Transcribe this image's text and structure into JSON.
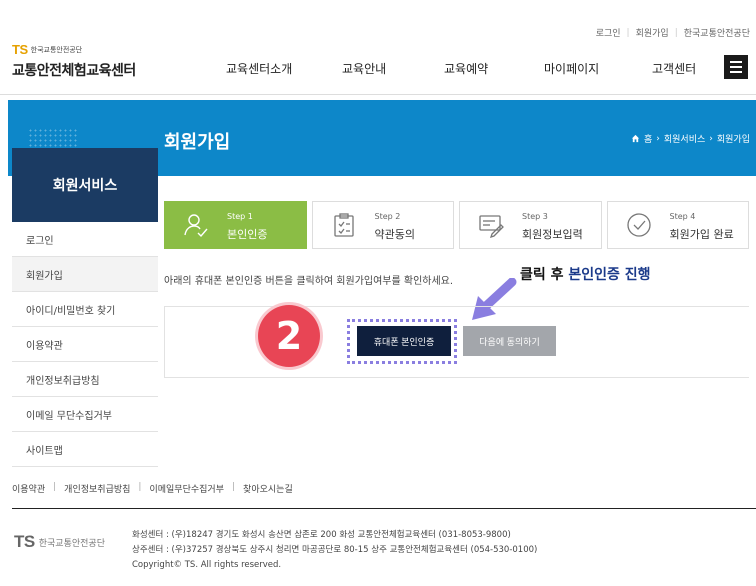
{
  "header": {
    "util_links": [
      "로그인",
      "회원가입",
      "한국교통안전공단"
    ],
    "logo_mark": "TS",
    "logo_org": "한국교통안전공단",
    "site_title": "교통안전체험교육센터",
    "nav": [
      "교육센터소개",
      "교육안내",
      "교육예약",
      "마이페이지",
      "고객센터"
    ],
    "menu_icon": "hamburger-icon"
  },
  "banner": {
    "title": "회원가입",
    "breadcrumb": [
      "홈",
      "회원서비스",
      "회원가입"
    ]
  },
  "sidebar": {
    "title": "회원서비스",
    "items": [
      {
        "label": "로그인"
      },
      {
        "label": "회원가입"
      },
      {
        "label": "아이디/비밀번호 찾기"
      },
      {
        "label": "이용약관"
      },
      {
        "label": "개인정보취급방침"
      },
      {
        "label": "이메일 무단수집거부"
      },
      {
        "label": "사이트맵"
      }
    ]
  },
  "steps": [
    {
      "num": "Step 1",
      "label": "본인인증",
      "icon": "person-check-icon"
    },
    {
      "num": "Step 2",
      "label": "약관동의",
      "icon": "clipboard-check-icon"
    },
    {
      "num": "Step 3",
      "label": "회원정보입력",
      "icon": "form-pen-icon"
    },
    {
      "num": "Step 4",
      "label": "회원가입 완료",
      "icon": "check-circle-icon"
    }
  ],
  "notice": "아래의 휴대폰 본인인증 버튼을 클릭하여 회원가입여부를 확인하세요.",
  "annotation": {
    "prefix": "클릭 후 ",
    "emphasis": "본인인증 진행",
    "badge": "2"
  },
  "buttons": {
    "auth": "휴대폰 본인인증",
    "next": "다음에 동의하기"
  },
  "footer": {
    "links": [
      "이용약관",
      "개인정보취급방침",
      "이메일무단수집거부",
      "찾아오시는길"
    ],
    "logo_mark": "TS",
    "logo_org": "한국교통안전공단",
    "lines": [
      "화성센터 : (우)18247 경기도 화성시 송산면 삼존로 200 화성 교통안전체험교육센터 (031-8053-9800)",
      "상주센터 : (우)37257 경상북도 상주시 청리면 마공공단로 80-15 상주 교통안전체험교육센터 (054-530-0100)",
      "Copyright© TS. All rights reserved."
    ]
  },
  "colors": {
    "banner": "#0d87c9",
    "sidebar_head": "#1b3b63",
    "step_active": "#8bbd45",
    "badge": "#e84555",
    "auth_button": "#0f1f3d",
    "annotation_frame": "#8a7ee0"
  }
}
